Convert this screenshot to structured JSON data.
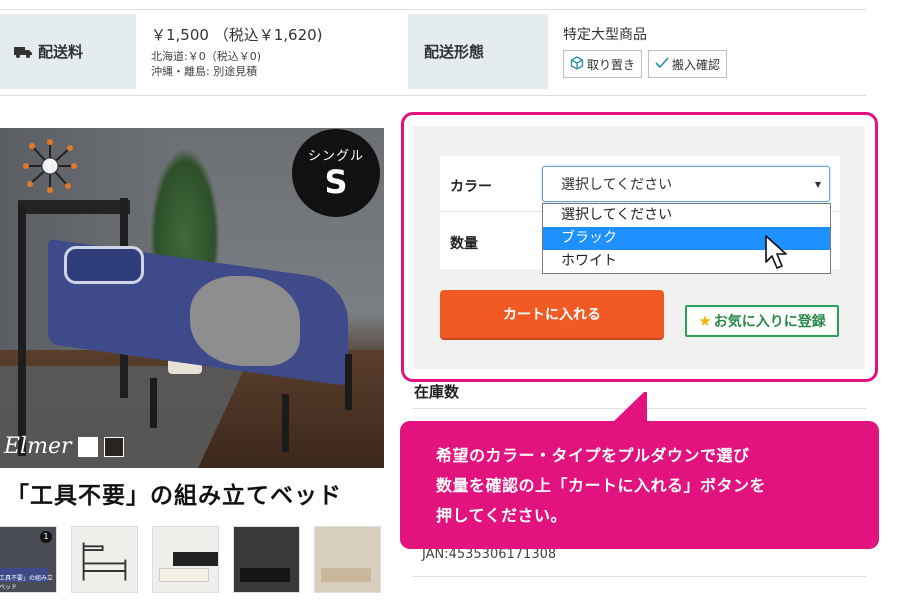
{
  "shipping": {
    "fee_label": "配送料",
    "fee_main": "￥1,500 （税込￥1,620)",
    "fee_hokkaido": "北海道:￥0（税込￥0)",
    "fee_okinawa": "沖縄・離島: 別途見積",
    "type_label": "配送形態",
    "type_value": "特定大型商品",
    "tags": [
      "取り置き",
      "搬入確認"
    ]
  },
  "product": {
    "size_badge_label": "シングル",
    "size_badge_letter": "S",
    "brand": "Elmer",
    "caption": "「工具不要」の組み立てベッド",
    "colors": {
      "swatch_white": "#ffffff",
      "swatch_black": "#2a2420"
    },
    "thumb_number": "1",
    "thumb_caption": "「工具不要」の組み立てベッド"
  },
  "cart": {
    "color_label": "カラー",
    "qty_label": "数量",
    "select_value": "選択してください",
    "options": [
      "選択してください",
      "ブラック",
      "ホワイト"
    ],
    "highlighted_option": "ブラック",
    "add_to_cart": "カートに入れる",
    "favorite": "お気に入りに登録",
    "accent": "#f15a24",
    "favorite_color": "#2aa35a"
  },
  "stock": {
    "label": "在庫数",
    "jan": "JAN:4535306171308"
  },
  "callout": {
    "lines": [
      "希望のカラー・タイプをプルダウンで選び",
      "数量を確認の上「カートに入れる」ボタンを",
      "押してください。"
    ],
    "color": "#e2137f"
  }
}
